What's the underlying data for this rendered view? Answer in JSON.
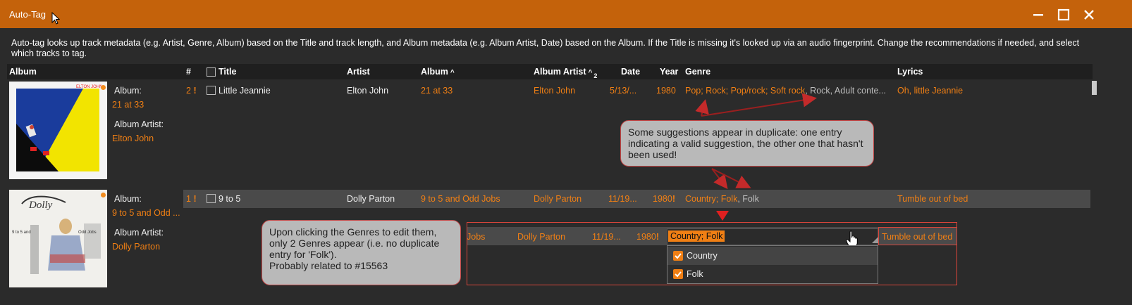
{
  "window": {
    "title": "Auto-Tag"
  },
  "description": "Auto-tag looks up track metadata (e.g. Artist, Genre, Album) based on the Title and track length, and Album metadata (e.g. Album Artist, Date) based on the Album. If the Title is missing it's looked up via an audio fingerprint. Change the recommendations if needed, and select which tracks to tag.",
  "columns": {
    "album": "Album",
    "num": "#",
    "title": "Title",
    "artist": "Artist",
    "album2": "Album",
    "album_sort": "^",
    "album_artist": "Album Artist",
    "album_artist_sort": "^",
    "album_artist_sort_index": "2",
    "date": "Date",
    "year": "Year",
    "genre": "Genre",
    "lyrics": "Lyrics"
  },
  "albums": [
    {
      "album_label": "Album:",
      "album": "21 at 33",
      "artist_label": "Album Artist:",
      "album_artist": "Elton John"
    },
    {
      "album_label": "Album:",
      "album": "9 to 5 and Odd ...",
      "artist_label": "Album Artist:",
      "album_artist": "Dolly Parton"
    }
  ],
  "rows": [
    {
      "num": "2",
      "flag": "!",
      "title": "Little Jeannie",
      "artist": "Elton John",
      "album": "21 at 33",
      "album_artist": "Elton John",
      "date": "5/13/...",
      "year": "1980",
      "year_flag": "",
      "genre_orange": "Pop; Rock; Pop/rock; Soft rock",
      "genre_sep": ", ",
      "genre_gray": "Rock, Adult conte...",
      "lyrics": "Oh, little Jeannie"
    },
    {
      "num": "1",
      "flag": "!",
      "title": "9 to 5",
      "artist": "Dolly Parton",
      "album": "9 to 5 and Odd Jobs",
      "album_artist": "Dolly Parton",
      "date": "11/19...",
      "year": "1980",
      "year_flag": "!",
      "genre_orange": "Country; Folk",
      "genre_sep": ", ",
      "genre_gray": "Folk",
      "lyrics": "Tumble out of bed"
    }
  ],
  "edit_row": {
    "album": "Jobs",
    "album_artist": "Dolly Parton",
    "date": "11/19...",
    "year": "1980",
    "year_flag": "!",
    "genre_value": "Country;  Folk",
    "lyrics": "Tumble out of bed"
  },
  "genre_options": [
    {
      "label": "Country",
      "checked": true
    },
    {
      "label": "Folk",
      "checked": true
    }
  ],
  "callouts": {
    "top": "Some suggestions appear in duplicate: one entry indicating a valid suggestion, the other one that hasn't been used!",
    "bottom_line1": "Upon clicking the Genres to edit them, only 2 Genres appear (i.e. no duplicate entry for 'Folk').",
    "bottom_line2": "Probably related to #15563"
  },
  "colors": {
    "titlebar": "#c4620b",
    "accent": "#f07f14",
    "background": "#2b2b2b",
    "annotation_red": "#c24545"
  }
}
